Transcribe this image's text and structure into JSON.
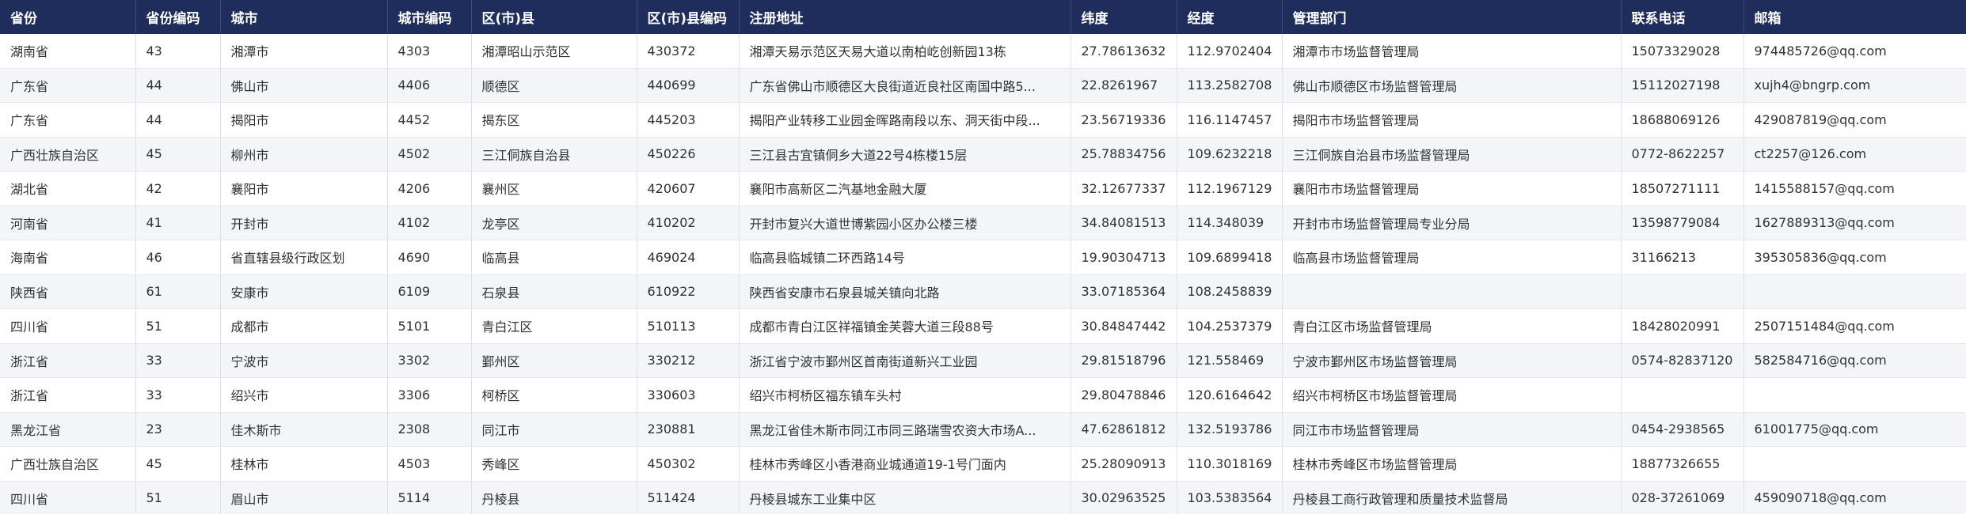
{
  "table": {
    "columns": [
      "省份",
      "省份编码",
      "城市",
      "城市编码",
      "区(市)县",
      "区(市)县编码",
      "注册地址",
      "纬度",
      "经度",
      "管理部门",
      "联系电话",
      "邮箱"
    ],
    "rows": [
      [
        "湖南省",
        "43",
        "湘潭市",
        "4303",
        "湘潭昭山示范区",
        "430372",
        "湘潭天易示范区天易大道以南柏屹创新园13栋",
        "27.78613632",
        "112.9702404",
        "湘潭市市场监督管理局",
        "15073329028",
        "974485726@qq.com"
      ],
      [
        "广东省",
        "44",
        "佛山市",
        "4406",
        "顺德区",
        "440699",
        "广东省佛山市顺德区大良街道近良社区南国中路5...",
        "22.8261967",
        "113.2582708",
        "佛山市顺德区市场监督管理局",
        "15112027198",
        "xujh4@bngrp.com"
      ],
      [
        "广东省",
        "44",
        "揭阳市",
        "4452",
        "揭东区",
        "445203",
        "揭阳产业转移工业园金晖路南段以东、洞天街中段...",
        "23.56719336",
        "116.1147457",
        "揭阳市市场监督管理局",
        "18688069126",
        "429087819@qq.com"
      ],
      [
        "广西壮族自治区",
        "45",
        "柳州市",
        "4502",
        "三江侗族自治县",
        "450226",
        "三江县古宜镇侗乡大道22号4栋楼15层",
        "25.78834756",
        "109.6232218",
        "三江侗族自治县市场监督管理局",
        "0772-8622257",
        "ct2257@126.com"
      ],
      [
        "湖北省",
        "42",
        "襄阳市",
        "4206",
        "襄州区",
        "420607",
        "襄阳市高新区二汽基地金融大厦",
        "32.12677337",
        "112.1967129",
        "襄阳市市场监督管理局",
        "18507271111",
        "1415588157@qq.com"
      ],
      [
        "河南省",
        "41",
        "开封市",
        "4102",
        "龙亭区",
        "410202",
        "开封市复兴大道世博紫园小区办公楼三楼",
        "34.84081513",
        "114.348039",
        "开封市市场监督管理局专业分局",
        "13598779084",
        "1627889313@qq.com"
      ],
      [
        "海南省",
        "46",
        "省直辖县级行政区划",
        "4690",
        "临高县",
        "469024",
        "临高县临城镇二环西路14号",
        "19.90304713",
        "109.6899418",
        "临高县市场监督管理局",
        "31166213",
        "395305836@qq.com"
      ],
      [
        "陕西省",
        "61",
        "安康市",
        "6109",
        "石泉县",
        "610922",
        "陕西省安康市石泉县城关镇向北路",
        "33.07185364",
        "108.2458839",
        "",
        "",
        ""
      ],
      [
        "四川省",
        "51",
        "成都市",
        "5101",
        "青白江区",
        "510113",
        "成都市青白江区祥福镇金芙蓉大道三段88号",
        "30.84847442",
        "104.2537379",
        "青白江区市场监督管理局",
        "18428020991",
        "2507151484@qq.com"
      ],
      [
        "浙江省",
        "33",
        "宁波市",
        "3302",
        "鄞州区",
        "330212",
        "浙江省宁波市鄞州区首南街道新兴工业园",
        "29.81518796",
        "121.558469",
        "宁波市鄞州区市场监督管理局",
        "0574-82837120",
        "582584716@qq.com"
      ],
      [
        "浙江省",
        "33",
        "绍兴市",
        "3306",
        "柯桥区",
        "330603",
        "绍兴市柯桥区福东镇车头村",
        "29.80478846",
        "120.6164642",
        "绍兴市柯桥区市场监督管理局",
        "",
        ""
      ],
      [
        "黑龙江省",
        "23",
        "佳木斯市",
        "2308",
        "同江市",
        "230881",
        "黑龙江省佳木斯市同江市同三路瑞雪农资大市场A...",
        "47.62861812",
        "132.5193786",
        "同江市市场监督管理局",
        "0454-2938565",
        "61001775@qq.com"
      ],
      [
        "广西壮族自治区",
        "45",
        "桂林市",
        "4503",
        "秀峰区",
        "450302",
        "桂林市秀峰区小香港商业城通道19-1号门面内",
        "25.28090913",
        "110.3018169",
        "桂林市秀峰区市场监督管理局",
        "18877326655",
        ""
      ],
      [
        "四川省",
        "51",
        "眉山市",
        "5114",
        "丹棱县",
        "511424",
        "丹棱县城东工业集中区",
        "30.02963525",
        "103.5383564",
        "丹棱县工商行政管理和质量技术监督局",
        "028-37261069",
        "459090718@qq.com"
      ]
    ]
  }
}
